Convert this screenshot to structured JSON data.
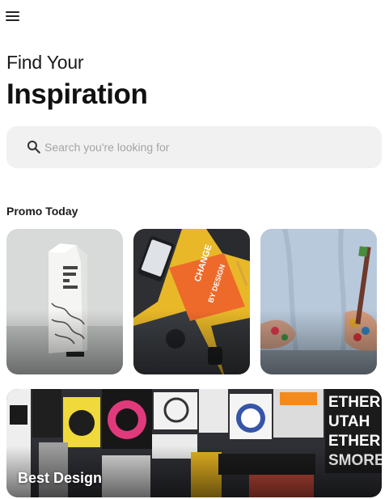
{
  "header": {
    "menu_icon": "hamburger-menu-icon",
    "title_line1": "Find Your",
    "title_line2": "Inspiration"
  },
  "search": {
    "icon": "search-icon",
    "placeholder": "Search you're looking for",
    "value": ""
  },
  "promo": {
    "section_label": "Promo Today",
    "cards": [
      {
        "subject": "boxed water carton"
      },
      {
        "subject": "change by design book on desk"
      },
      {
        "subject": "paint covered hands with brush"
      }
    ]
  },
  "feature": {
    "label": "Best Design"
  },
  "colors": {
    "background": "#ffffff",
    "search_bg": "#f1f1f1",
    "placeholder": "#a4a4a4",
    "text": "#111111"
  }
}
